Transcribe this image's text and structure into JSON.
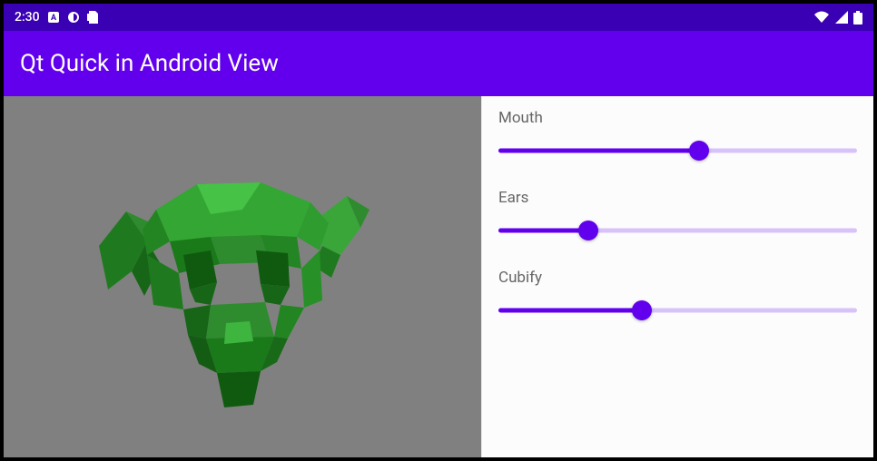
{
  "status_bar": {
    "time": "2:30"
  },
  "title_bar": {
    "title": "Qt Quick in Android View"
  },
  "controls": {
    "sliders": [
      {
        "label": "Mouth",
        "value": 56
      },
      {
        "label": "Ears",
        "value": 25
      },
      {
        "label": "Cubify",
        "value": 40
      }
    ]
  },
  "colors": {
    "status_bg": "#3a00b3",
    "title_bg": "#6200ee",
    "accent": "#6200ee",
    "viewport_bg": "#808080",
    "model_color": "#2e8b2e"
  }
}
